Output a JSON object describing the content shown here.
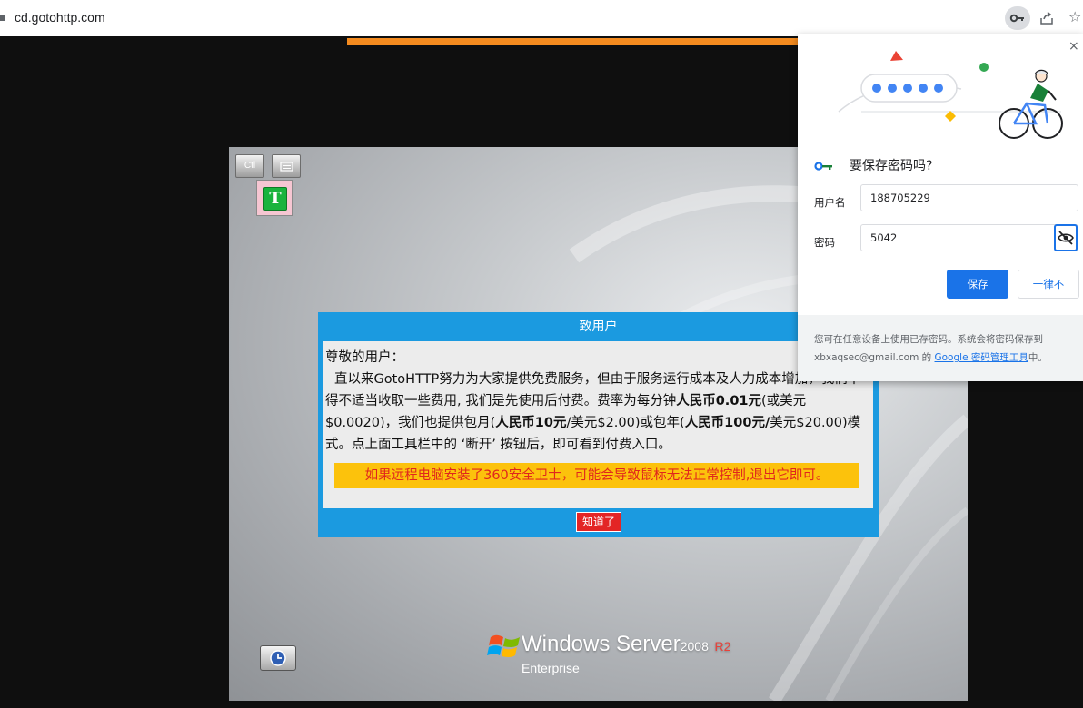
{
  "browser": {
    "url": "cd.gotohttp.com"
  },
  "remote": {
    "toolbar": {
      "ctrl_label": "Ctl"
    },
    "t_icon_label": "T",
    "windows": {
      "brand": "Windows Server",
      "version": "2008",
      "release": "R2",
      "edition": "Enterprise"
    }
  },
  "dialog": {
    "title": "致用户",
    "greeting": "尊敬的用户：",
    "p1": "直以来GotoHTTP努力为大家提供免费服务，但由于服务运行成本及人力成本增加，我们不得不适当收取一些费用, 我们是先使用后付费。费率为每分钟",
    "rate_bold": "人民币0.01元",
    "p2": "(或美元$0.0020)，我们也提供包月(",
    "monthly_bold": "人民币10元",
    "p3": "/美元$2.00)或包年(",
    "yearly_bold": "人民币100元/",
    "p4": "美元$20.00)模式。点上面工具栏中的 ‘断开’ 按钮后，即可看到付费入口。",
    "warning": "如果远程电脑安装了360安全卫士，可能会导致鼠标无法正常控制,退出它即可。",
    "ok_label": "知道了"
  },
  "password_popup": {
    "close_label": "×",
    "title": "要保存密码吗?",
    "username_label": "用户名",
    "username_value": "188705229",
    "password_label": "密码",
    "password_value": "5042",
    "save_label": "保存",
    "never_label": "一律不",
    "footer_text": "您可在任意设备上使用已存密码。系统会将密码保存到 xbxaqsec@gmail.com 的 ",
    "footer_link": "Google 密码管理工具",
    "footer_end": "中。"
  },
  "colors": {
    "dialog_blue": "#1b9ae0",
    "warn_yellow": "#fcc20c",
    "warn_red": "#e0261d",
    "ok_red": "#e32525",
    "google_blue": "#1a73e8",
    "progress_orange": "#f48b1f"
  }
}
